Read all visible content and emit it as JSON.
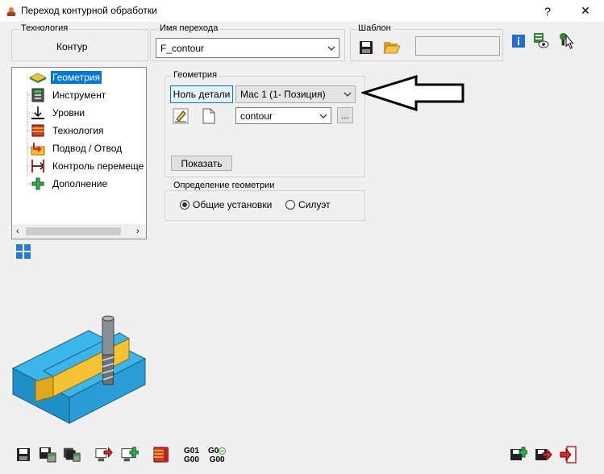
{
  "window": {
    "title": "Переход контурной обработки",
    "help": "?",
    "close": "✕"
  },
  "header": {
    "technology_label": "Технология",
    "technology_value": "Контур",
    "name_label": "Имя перехода",
    "name_value": "F_contour",
    "template_label": "Шаблон",
    "template_value": ""
  },
  "tree": {
    "items": [
      {
        "label": "Геометрия",
        "icon": "geometry-icon",
        "selected": true
      },
      {
        "label": "Инструмент",
        "icon": "tool-icon"
      },
      {
        "label": "Уровни",
        "icon": "levels-icon"
      },
      {
        "label": "Технология",
        "icon": "technology-icon"
      },
      {
        "label": "Подвод / Отвод",
        "icon": "approach-icon"
      },
      {
        "label": "Контроль перемеще",
        "icon": "motion-control-icon"
      },
      {
        "label": "Дополнение",
        "icon": "addition-icon"
      }
    ]
  },
  "geometry": {
    "group_label": "Геометрия",
    "zero_button": "Ноль детали",
    "position_value": "Мас 1 (1- Позиция)",
    "contour_value": "contour",
    "ellipsis": "...",
    "show_button": "Показать"
  },
  "definition": {
    "group_label": "Определение геометрии",
    "options": [
      {
        "label": "Общие установки",
        "checked": true
      },
      {
        "label": "Силуэт",
        "checked": false
      }
    ]
  },
  "bottom": {
    "g01": "G01",
    "g00a": "G00",
    "g0": "G0",
    "g00b": "G00"
  },
  "colors": {
    "selection": "#0078d7",
    "part_blue": "#2ea8e0",
    "part_yellow": "#f5c233"
  }
}
